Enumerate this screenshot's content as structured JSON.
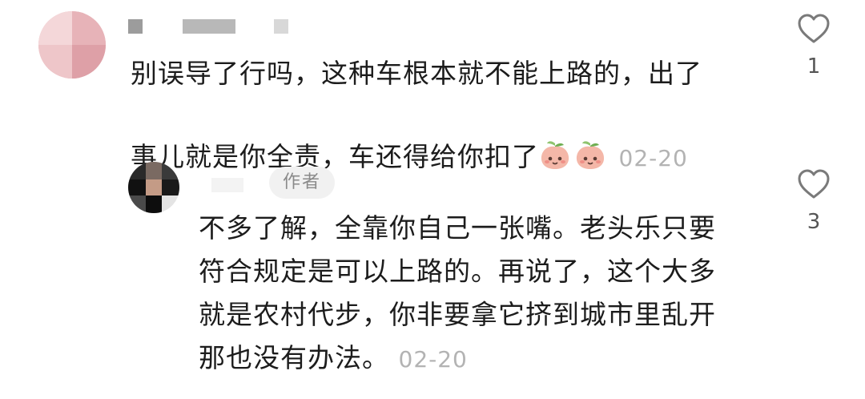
{
  "comments": [
    {
      "text": "别误导了行吗，这种车根本就不能上路的，出了\n事儿就是你全责，车还得给你扣了",
      "emoji_icons": [
        "peach-face-icon",
        "peach-face-icon"
      ],
      "date": "02-20",
      "like_icon": "heart-outline-icon",
      "like_count": "1"
    }
  ],
  "reply": {
    "author_badge": "作者",
    "text": "不多了解，全靠你自己一张嘴。老头乐只要\n符合规定是可以上路的。再说了，这个大多\n就是农村代步，你非要拿它挤到城市里乱开\n那也没有办法。",
    "date": "02-20",
    "like_icon": "heart-outline-icon",
    "like_count": "3"
  },
  "colors": {
    "text": "#1c1c1c",
    "date": "#b3b3b3",
    "badge_bg": "#f1f1f1",
    "badge_text": "#8a8a8a",
    "heart": "#7a7a7a"
  }
}
